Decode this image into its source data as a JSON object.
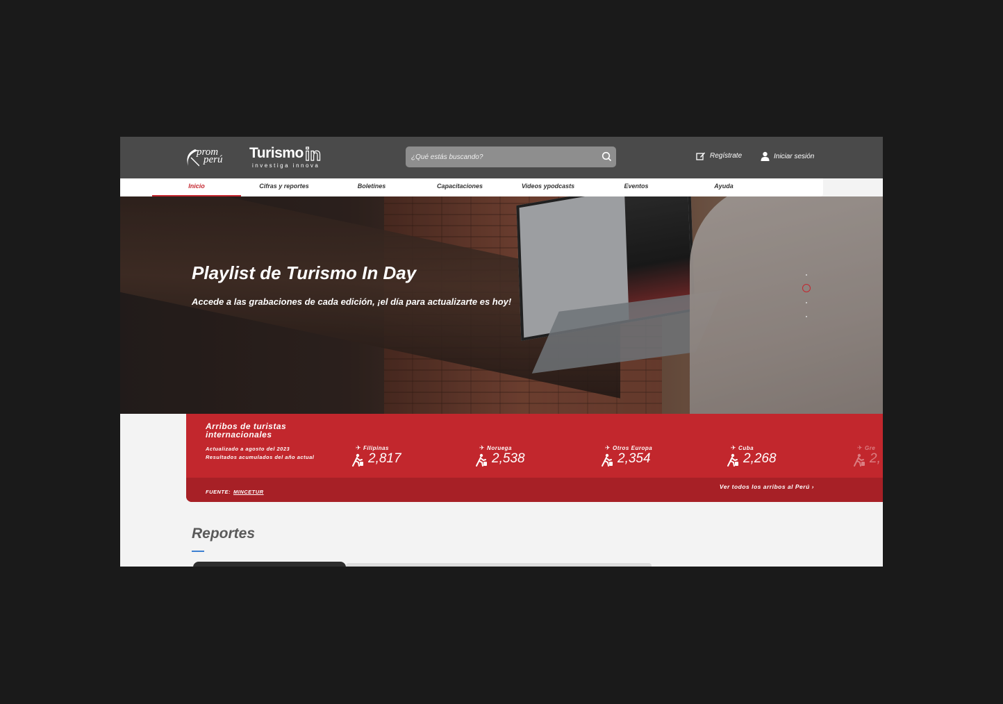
{
  "header": {
    "logo_prom_line1": "prom",
    "logo_prom_line2": "perú",
    "logo_turismo": "Turismo",
    "logo_turismo_in": "in",
    "logo_turismo_tagline": "investiga innova",
    "search_placeholder": "¿Qué estás buscando?",
    "register_label": "Regístrate",
    "login_label": "Iniciar sesión"
  },
  "nav": {
    "items": [
      {
        "label": "Inicio",
        "active": true
      },
      {
        "label": "Cifras y reportes"
      },
      {
        "label": "Boletines"
      },
      {
        "label": "Capacitaciones"
      },
      {
        "label": "Videos ypodcasts"
      },
      {
        "label": "Eventos"
      },
      {
        "label": "Ayuda"
      }
    ]
  },
  "hero": {
    "title": "Playlist de Turismo In Day",
    "subtitle": "Accede a las grabaciones de cada edición, ¡el día para actualizarte es hoy!"
  },
  "arrivals": {
    "title": "Arribos de turistas internacionales",
    "updated": "Actualizado a agosto del 2023 Resultados acumulados del año actual",
    "stats": [
      {
        "country": "Filipinas",
        "value": "2,817"
      },
      {
        "country": "Noruega",
        "value": "2,538"
      },
      {
        "country": "Otros Europa",
        "value": "2,354"
      },
      {
        "country": "Cuba",
        "value": "2,268"
      },
      {
        "country": "Gre",
        "value": "2,"
      }
    ],
    "source_label": "FUENTE:",
    "source_link": "MINCETUR",
    "see_all": "Ver todos los arribos al Perú"
  },
  "reports": {
    "title": "Reportes"
  },
  "colors": {
    "accent_red": "#c2272d",
    "header_gray": "#4a4a4a",
    "accent_blue": "#3c7fd1"
  }
}
